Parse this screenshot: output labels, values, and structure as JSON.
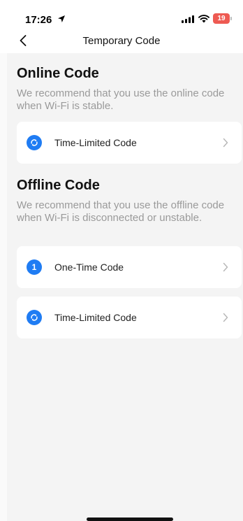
{
  "status_bar": {
    "time": "17:26",
    "battery": "19",
    "battery_color": "#ee5a52"
  },
  "nav": {
    "title": "Temporary Code",
    "back_icon": "chevron-left-icon"
  },
  "online": {
    "title": "Online Code",
    "description": "We recommend that you use the online code when Wi-Fi is stable.",
    "items": [
      {
        "label": "Time-Limited Code",
        "icon": "refresh-icon"
      }
    ]
  },
  "offline": {
    "title": "Offline Code",
    "description": "We recommend that you use the offline code when Wi-Fi is disconnected or unstable.",
    "items": [
      {
        "label": "One-Time Code",
        "icon_text": "1",
        "icon": "number-one-icon"
      },
      {
        "label": "Time-Limited Code",
        "icon": "refresh-icon"
      }
    ]
  },
  "colors": {
    "accent": "#1f7cf3",
    "background": "#f4f4f4",
    "secondary_text": "#9a9a9a"
  }
}
